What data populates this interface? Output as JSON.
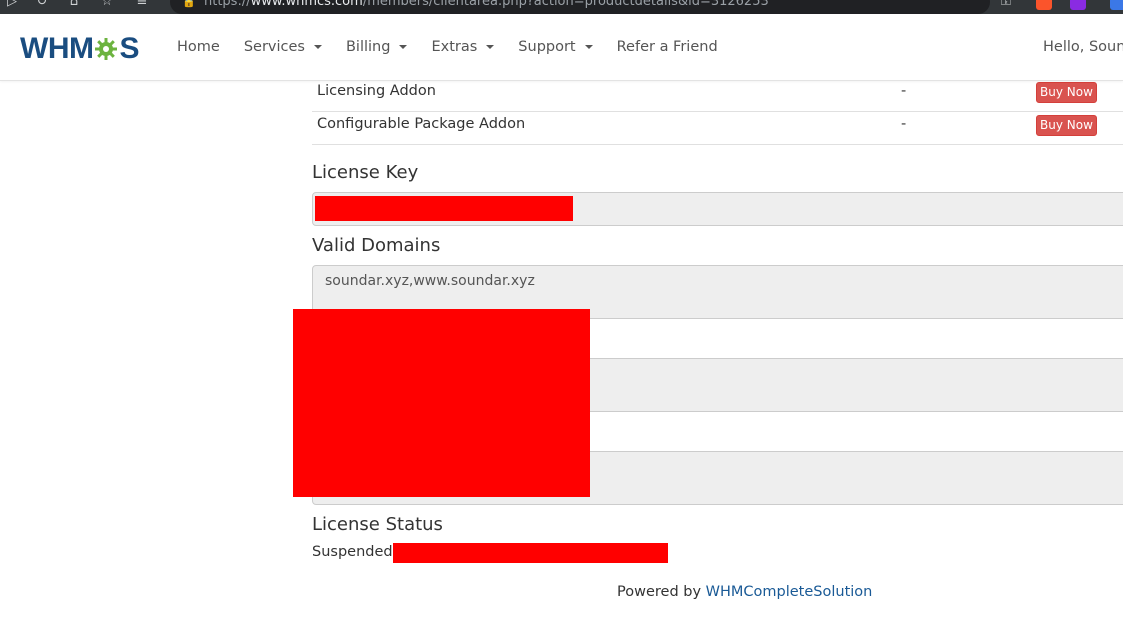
{
  "browser": {
    "url_prefix": "https://",
    "url_host": "www.whmcs.com",
    "url_path": "/members/clientarea.php?action=productdetails&id=3126253"
  },
  "navbar": {
    "logo_left": "WHM",
    "logo_right": "S",
    "items": [
      {
        "label": "Home",
        "dropdown": false
      },
      {
        "label": "Services",
        "dropdown": true
      },
      {
        "label": "Billing",
        "dropdown": true
      },
      {
        "label": "Extras",
        "dropdown": true
      },
      {
        "label": "Support",
        "dropdown": true
      },
      {
        "label": "Refer a Friend",
        "dropdown": false
      }
    ],
    "greeting": "Hello, Sound"
  },
  "addons": [
    {
      "name": "Licensing Addon",
      "price": "-",
      "action": "Buy Now"
    },
    {
      "name": "Configurable Package Addon",
      "price": "-",
      "action": "Buy Now"
    }
  ],
  "license_key": {
    "title": "License Key",
    "value": ""
  },
  "valid_domains": {
    "title": "Valid Domains",
    "value": "soundar.xyz,www.soundar.xyz"
  },
  "license_status": {
    "title": "License Status",
    "value": "Suspended"
  },
  "footer": {
    "prefix": "Powered by ",
    "link": "WHMCompleteSolution"
  },
  "colors": {
    "brand": "#1a4d80",
    "logo_gear": "#6cb33f",
    "danger": "#d9534f",
    "link": "#1a5a96"
  }
}
